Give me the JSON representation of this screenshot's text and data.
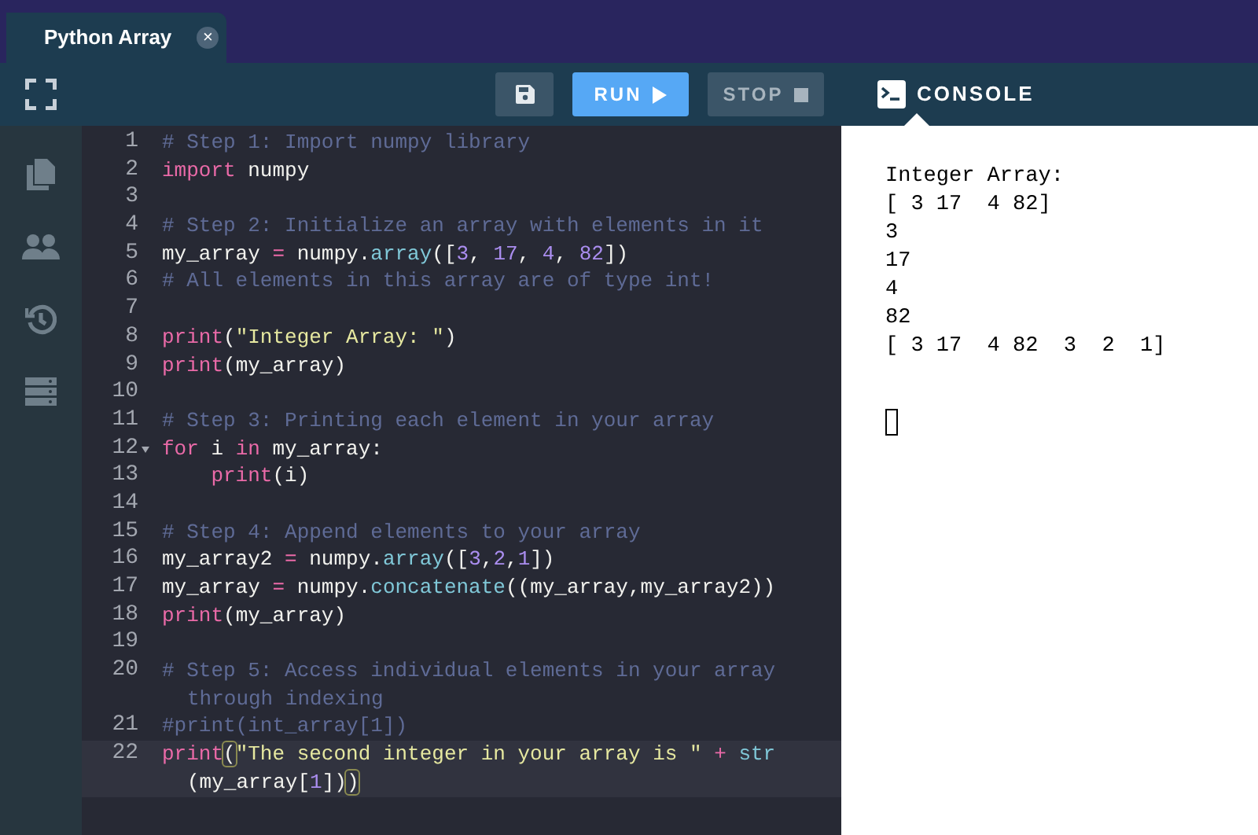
{
  "tabs": [
    {
      "label": "Python Array",
      "selected": true,
      "close": "×"
    }
  ],
  "toolbar": {
    "buttons": [
      {
        "kind": "save"
      },
      {
        "kind": "run",
        "label": "RUN",
        "disabled": false
      },
      {
        "kind": "stop",
        "label": "STOP",
        "disabled": true
      }
    ]
  },
  "sidebar": {
    "items": [
      {
        "kind": "files"
      },
      {
        "kind": "people"
      },
      {
        "kind": "history"
      },
      {
        "kind": "database"
      }
    ]
  },
  "editor": {
    "lines": [
      {
        "number": "1",
        "parts": [
          {
            "tokens": [
              {
                "kind": "comment",
                "text": "# Step 1: Import numpy library"
              }
            ]
          }
        ]
      },
      {
        "number": "2",
        "parts": [
          {
            "tokens": [
              {
                "kind": "keyword",
                "text": "import"
              },
              {
                "kind": "plain",
                "text": " numpy"
              }
            ]
          }
        ]
      },
      {
        "number": "3"
      },
      {
        "number": "4",
        "parts": [
          {
            "tokens": [
              {
                "kind": "comment",
                "text": "# Step 2: Initialize an array with elements in it"
              }
            ]
          }
        ]
      },
      {
        "number": "5",
        "parts": [
          {
            "tokens": [
              {
                "kind": "plain",
                "text": "my_array "
              },
              {
                "kind": "operator",
                "text": "="
              },
              {
                "kind": "plain",
                "text": " numpy."
              },
              {
                "kind": "function",
                "text": "array"
              },
              {
                "kind": "plain",
                "text": "(["
              },
              {
                "kind": "number",
                "text": "3"
              },
              {
                "kind": "plain",
                "text": ", "
              },
              {
                "kind": "number",
                "text": "17"
              },
              {
                "kind": "plain",
                "text": ", "
              },
              {
                "kind": "number",
                "text": "4"
              },
              {
                "kind": "plain",
                "text": ", "
              },
              {
                "kind": "number",
                "text": "82"
              },
              {
                "kind": "plain",
                "text": "])"
              }
            ]
          }
        ]
      },
      {
        "number": "6",
        "parts": [
          {
            "tokens": [
              {
                "kind": "comment",
                "text": "# All elements in this array are of type int!"
              }
            ]
          }
        ]
      },
      {
        "number": "7"
      },
      {
        "number": "8",
        "parts": [
          {
            "tokens": [
              {
                "kind": "keyword",
                "text": "print"
              },
              {
                "kind": "plain",
                "text": "("
              },
              {
                "kind": "string",
                "text": "\"Integer Array: \""
              },
              {
                "kind": "plain",
                "text": ")"
              }
            ]
          }
        ]
      },
      {
        "number": "9",
        "parts": [
          {
            "tokens": [
              {
                "kind": "keyword",
                "text": "print"
              },
              {
                "kind": "plain",
                "text": "(my_array)"
              }
            ]
          }
        ]
      },
      {
        "number": "10"
      },
      {
        "number": "11",
        "parts": [
          {
            "tokens": [
              {
                "kind": "comment",
                "text": "# Step 3: Printing each element in your array"
              }
            ]
          }
        ]
      },
      {
        "number": "12",
        "folded": false,
        "parts": [
          {
            "tokens": [
              {
                "kind": "keyword",
                "text": "for"
              },
              {
                "kind": "plain",
                "text": " i "
              },
              {
                "kind": "keyword",
                "text": "in"
              },
              {
                "kind": "plain",
                "text": " my_array:"
              }
            ]
          }
        ]
      },
      {
        "number": "13",
        "parts": [
          {
            "tokens": [
              {
                "kind": "keyword",
                "text": "    print"
              },
              {
                "kind": "plain",
                "text": "(i)"
              }
            ]
          }
        ]
      },
      {
        "number": "14"
      },
      {
        "number": "15",
        "parts": [
          {
            "tokens": [
              {
                "kind": "comment",
                "text": "# Step 4: Append elements to your array"
              }
            ]
          }
        ]
      },
      {
        "number": "16",
        "parts": [
          {
            "tokens": [
              {
                "kind": "plain",
                "text": "my_array2 "
              },
              {
                "kind": "operator",
                "text": "="
              },
              {
                "kind": "plain",
                "text": " numpy."
              },
              {
                "kind": "function",
                "text": "array"
              },
              {
                "kind": "plain",
                "text": "(["
              },
              {
                "kind": "number",
                "text": "3"
              },
              {
                "kind": "plain",
                "text": ","
              },
              {
                "kind": "number",
                "text": "2"
              },
              {
                "kind": "plain",
                "text": ","
              },
              {
                "kind": "number",
                "text": "1"
              },
              {
                "kind": "plain",
                "text": "])"
              }
            ]
          }
        ]
      },
      {
        "number": "17",
        "parts": [
          {
            "tokens": [
              {
                "kind": "plain",
                "text": "my_array "
              },
              {
                "kind": "operator",
                "text": "="
              },
              {
                "kind": "plain",
                "text": " numpy."
              },
              {
                "kind": "function",
                "text": "concatenate"
              },
              {
                "kind": "plain",
                "text": "((my_array,my_array2))"
              }
            ]
          }
        ]
      },
      {
        "number": "18",
        "parts": [
          {
            "tokens": [
              {
                "kind": "keyword",
                "text": "print"
              },
              {
                "kind": "plain",
                "text": "(my_array)"
              }
            ]
          }
        ]
      },
      {
        "number": "19"
      },
      {
        "number": "20",
        "parts": [
          {
            "tokens": [
              {
                "kind": "comment",
                "text": "# Step 5: Access individual elements in your array"
              }
            ]
          },
          {
            "tokens": [
              {
                "kind": "comment",
                "text": "through indexing"
              }
            ]
          }
        ]
      },
      {
        "number": "21",
        "parts": [
          {
            "tokens": [
              {
                "kind": "comment",
                "text": "#print(int_array[1])"
              }
            ]
          }
        ]
      },
      {
        "number": "22",
        "active": true,
        "parts": [
          {
            "tokens": [
              {
                "kind": "keyword",
                "text": "print"
              },
              {
                "kind": "bracket",
                "text": "("
              },
              {
                "kind": "string",
                "text": "\"The second integer in your array is \""
              },
              {
                "kind": "operator",
                "text": " + "
              },
              {
                "kind": "function",
                "text": "str"
              }
            ]
          },
          {
            "tokens": [
              {
                "kind": "plain",
                "text": "(my_array["
              },
              {
                "kind": "number",
                "text": "1"
              },
              {
                "kind": "plain",
                "text": "])"
              },
              {
                "kind": "bracket",
                "text": ")"
              }
            ]
          }
        ]
      }
    ]
  },
  "console": {
    "title": "CONSOLE",
    "output": [
      "Integer Array:",
      "[ 3 17  4 82]",
      "3",
      "17",
      "4",
      "82",
      "[ 3 17  4 82  3  2  1]"
    ],
    "cursor": true
  }
}
